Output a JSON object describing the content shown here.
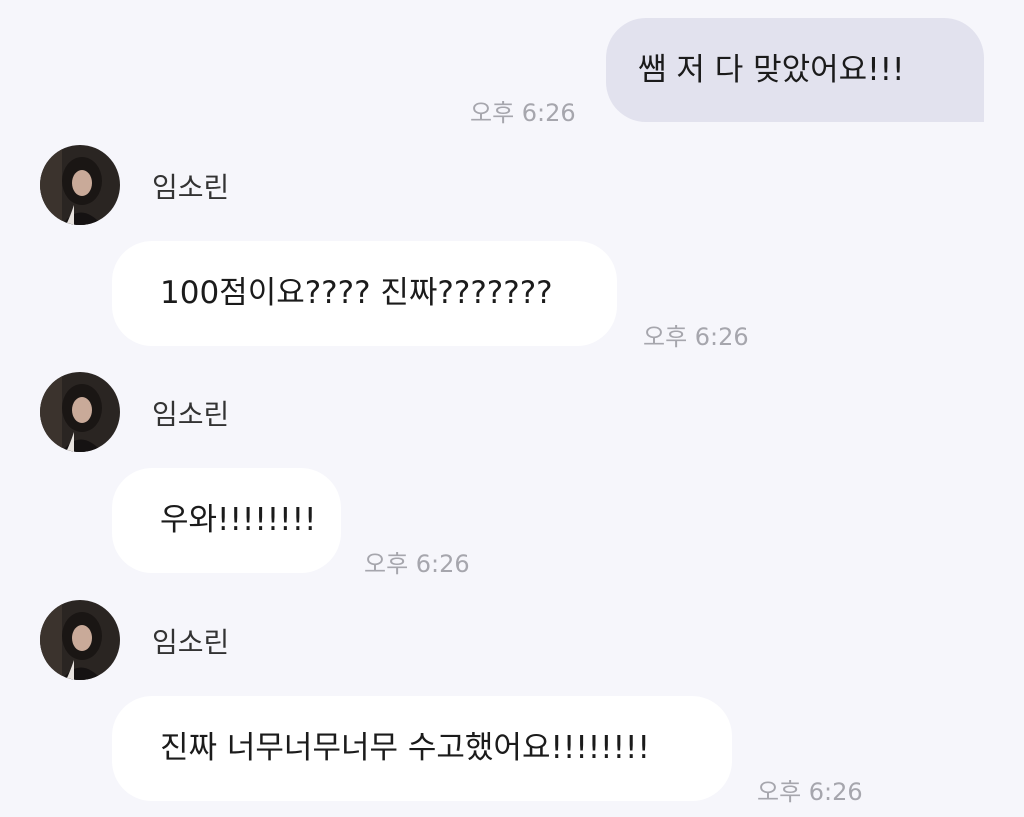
{
  "messages": [
    {
      "direction": "outgoing",
      "text": "쌤 저 다 맞았어요!!!",
      "time": "오후 6:26"
    },
    {
      "direction": "incoming",
      "sender": "임소린",
      "text": "100점이요???? 진짜???????",
      "time": "오후 6:26"
    },
    {
      "direction": "incoming",
      "sender": "임소린",
      "text": "우와!!!!!!!!",
      "time": "오후 6:26"
    },
    {
      "direction": "incoming",
      "sender": "임소린",
      "text": "진짜 너무너무너무 수고했어요!!!!!!!!",
      "time": "오후 6:26"
    }
  ],
  "colors": {
    "background": "#f6f6fb",
    "outgoing_bubble": "#e2e2ee",
    "incoming_bubble": "#ffffff",
    "timestamp": "#a6a6ad"
  },
  "icons": {
    "avatar": "profile-photo"
  }
}
